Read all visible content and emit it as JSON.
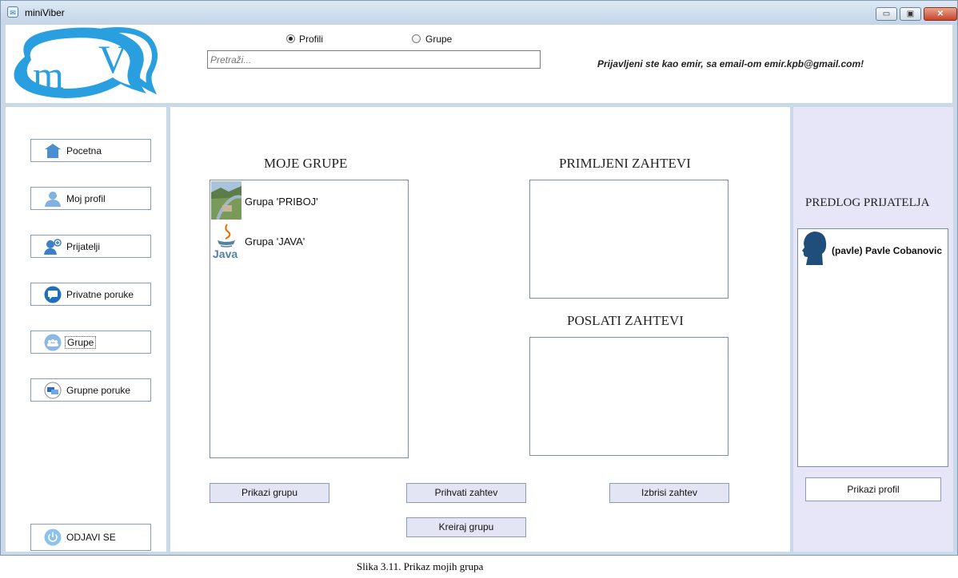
{
  "window": {
    "title": "miniViber",
    "app_icon": "chat-bubble-icon"
  },
  "window_controls": {
    "minimize": "▭",
    "maximize": "▣",
    "close": "✕"
  },
  "header": {
    "logo_text_m": "m",
    "logo_text_v": "V",
    "radio_profili": "Profili",
    "radio_grupe": "Grupe",
    "selected_radio": "Profili",
    "search_placeholder": "Pretraži...",
    "login_status": "Prijavljeni ste kao emir, sa email-om emir.kpb@gmail.com!"
  },
  "nav": [
    {
      "label": "Pocetna",
      "icon": "home-icon"
    },
    {
      "label": "Moj profil",
      "icon": "user-icon"
    },
    {
      "label": "Prijatelji",
      "icon": "friends-icon"
    },
    {
      "label": "Privatne poruke",
      "icon": "message-icon"
    },
    {
      "label": "Grupe",
      "icon": "group-icon"
    },
    {
      "label": "Grupne poruke",
      "icon": "group-messages-icon"
    },
    {
      "label": "ODJAVI SE",
      "icon": "power-icon"
    }
  ],
  "center": {
    "my_groups_title": "MOJE GRUPE",
    "received_title": "PRIMLJENI ZAHTEVI",
    "sent_title": "POSLATI ZAHTEVI",
    "groups": [
      {
        "name": "Grupa 'PRIBOJ'",
        "icon": "landscape-thumbnail"
      },
      {
        "name": "Grupa 'JAVA'",
        "icon": "java-logo-icon",
        "icon_text": "Java"
      }
    ],
    "buttons": {
      "show_group": "Prikazi grupu",
      "accept_request": "Prihvati zahtev",
      "delete_request": "Izbrisi zahtev",
      "create_group": "Kreiraj grupu"
    }
  },
  "right": {
    "title": "PREDLOG PRIJATELJA",
    "suggestions": [
      {
        "name": "(pavle) Pavle Cobanovic",
        "icon": "person-silhouette-icon"
      }
    ],
    "show_profile": "Prikazi profil"
  },
  "caption": "Slika 3.11. Prikaz mojih grupa",
  "colors": {
    "accent": "#2a9fe0",
    "panel_border": "#9ab0cc",
    "button_fill": "#e3e4f4",
    "side_panel": "#e6e6f8"
  }
}
